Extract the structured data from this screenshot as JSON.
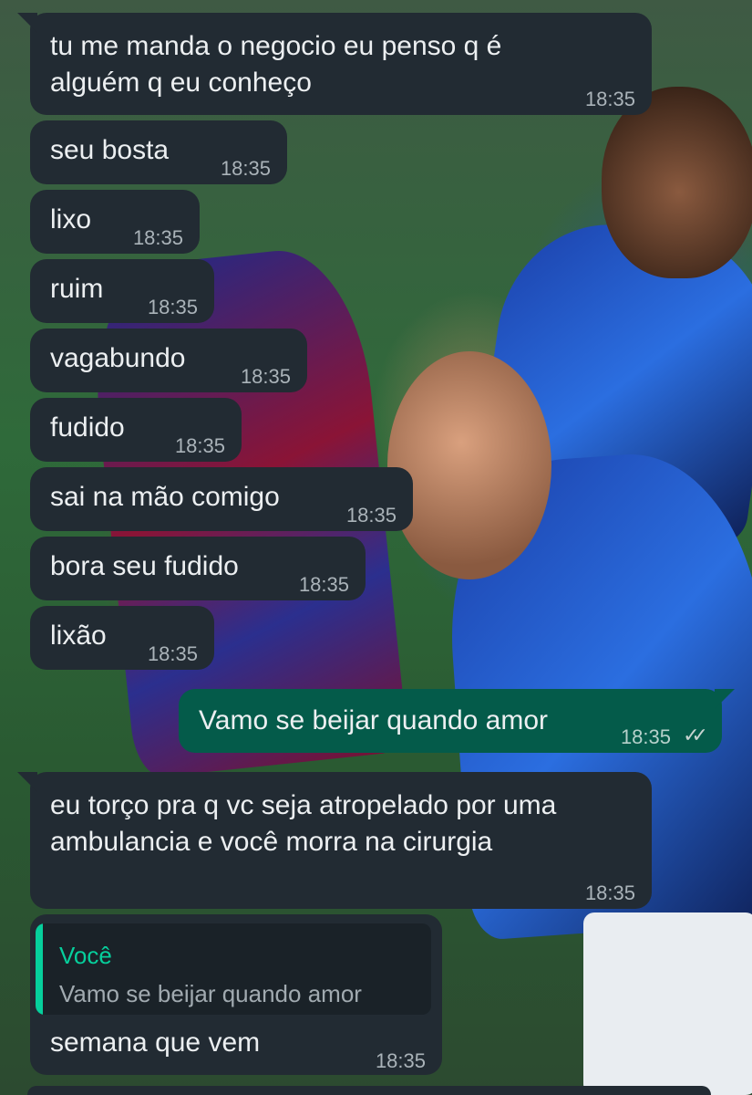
{
  "colors": {
    "incoming_bubble": "#222b33",
    "outgoing_bubble": "#045b4a",
    "quote_accent": "#06cf9c",
    "text": "#eceff1",
    "timestamp": "#aab3b9"
  },
  "messages": [
    {
      "direction": "in",
      "lines": [
        "tu me manda o negocio eu penso q é",
        "alguém q eu conheço"
      ],
      "time": "18:35"
    },
    {
      "direction": "in",
      "lines": [
        "seu bosta"
      ],
      "time": "18:35"
    },
    {
      "direction": "in",
      "lines": [
        "lixo"
      ],
      "time": "18:35"
    },
    {
      "direction": "in",
      "lines": [
        "ruim"
      ],
      "time": "18:35"
    },
    {
      "direction": "in",
      "lines": [
        "vagabundo"
      ],
      "time": "18:35"
    },
    {
      "direction": "in",
      "lines": [
        "fudido"
      ],
      "time": "18:35"
    },
    {
      "direction": "in",
      "lines": [
        "sai na mão comigo"
      ],
      "time": "18:35"
    },
    {
      "direction": "in",
      "lines": [
        "bora seu fudido"
      ],
      "time": "18:35"
    },
    {
      "direction": "in",
      "lines": [
        "lixão"
      ],
      "time": "18:35"
    },
    {
      "direction": "out",
      "lines": [
        "Vamo se beijar quando amor"
      ],
      "time": "18:35",
      "status_icon": "double-check-icon"
    },
    {
      "direction": "in",
      "lines": [
        "eu torço pra q vc seja atropelado por uma",
        "ambulancia e você morra na cirurgia"
      ],
      "time": "18:35"
    },
    {
      "direction": "in",
      "quote": {
        "author": "Você",
        "text": "Vamo se beijar quando amor"
      },
      "lines": [
        "semana que vem"
      ],
      "time": "18:35"
    }
  ]
}
